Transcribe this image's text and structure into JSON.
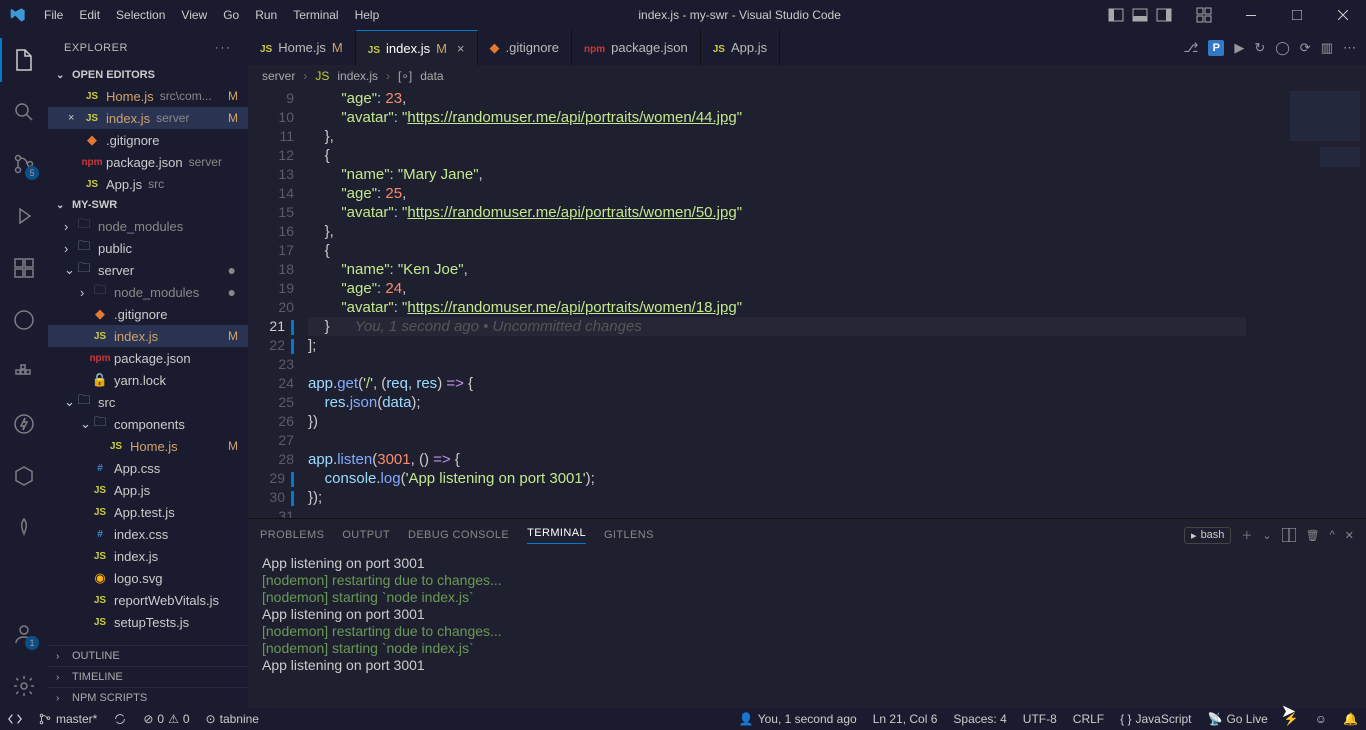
{
  "window": {
    "title": "index.js - my-swr - Visual Studio Code"
  },
  "menu": [
    "File",
    "Edit",
    "Selection",
    "View",
    "Go",
    "Run",
    "Terminal",
    "Help"
  ],
  "activity": {
    "scm_badge": "5",
    "acct_badge": "1"
  },
  "sidebar": {
    "title": "EXPLORER",
    "open_editors_label": "OPEN EDITORS",
    "open_editors": [
      {
        "name": "Home.js",
        "dir": "src\\com...",
        "mod": true
      },
      {
        "name": "index.js",
        "dir": "server",
        "mod": true,
        "active": true
      },
      {
        "name": ".gitignore",
        "dir": "",
        "mod": false
      },
      {
        "name": "package.json",
        "dir": "server",
        "mod": false
      },
      {
        "name": "App.js",
        "dir": "src",
        "mod": false
      }
    ],
    "project_label": "MY-SWR",
    "tree": [
      {
        "kind": "folder",
        "name": "node_modules",
        "pad": 1,
        "chev": "›",
        "faded": true
      },
      {
        "kind": "folder",
        "name": "public",
        "pad": 1,
        "chev": "›"
      },
      {
        "kind": "folder",
        "name": "server",
        "pad": 1,
        "chev": "⌄",
        "dot": true
      },
      {
        "kind": "folder",
        "name": "node_modules",
        "pad": 2,
        "chev": "›",
        "faded": true,
        "dot": true
      },
      {
        "kind": "file",
        "name": ".gitignore",
        "pad": 2,
        "ic": "git"
      },
      {
        "kind": "file",
        "name": "index.js",
        "pad": 2,
        "ic": "js",
        "mod": true,
        "sel": true
      },
      {
        "kind": "file",
        "name": "package.json",
        "pad": 2,
        "ic": "npm"
      },
      {
        "kind": "file",
        "name": "yarn.lock",
        "pad": 2,
        "ic": "lock"
      },
      {
        "kind": "folder",
        "name": "src",
        "pad": 1,
        "chev": "⌄"
      },
      {
        "kind": "folder",
        "name": "components",
        "pad": 2,
        "chev": "⌄"
      },
      {
        "kind": "file",
        "name": "Home.js",
        "pad": 3,
        "ic": "js",
        "mod": true
      },
      {
        "kind": "file",
        "name": "App.css",
        "pad": 2,
        "ic": "css"
      },
      {
        "kind": "file",
        "name": "App.js",
        "pad": 2,
        "ic": "js"
      },
      {
        "kind": "file",
        "name": "App.test.js",
        "pad": 2,
        "ic": "js"
      },
      {
        "kind": "file",
        "name": "index.css",
        "pad": 2,
        "ic": "css"
      },
      {
        "kind": "file",
        "name": "index.js",
        "pad": 2,
        "ic": "js"
      },
      {
        "kind": "file",
        "name": "logo.svg",
        "pad": 2,
        "ic": "svg"
      },
      {
        "kind": "file",
        "name": "reportWebVitals.js",
        "pad": 2,
        "ic": "js"
      },
      {
        "kind": "file",
        "name": "setupTests.js",
        "pad": 2,
        "ic": "js"
      }
    ],
    "outline": "OUTLINE",
    "timeline": "TIMELINE",
    "npm": "NPM SCRIPTS"
  },
  "tabs": [
    {
      "name": "Home.js",
      "mod": true
    },
    {
      "name": "index.js",
      "mod": true,
      "active": true
    },
    {
      "name": ".gitignore",
      "ic": "git"
    },
    {
      "name": "package.json",
      "ic": "npm"
    },
    {
      "name": "App.js"
    }
  ],
  "breadcrumb": {
    "a": "server",
    "b": "index.js",
    "c": "data"
  },
  "code": {
    "lines": [
      {
        "n": 9,
        "html": "        <span class='str'>\"age\"</span><span class='pun'>:</span> <span class='num'>23</span><span class='pl'>,</span>"
      },
      {
        "n": 10,
        "html": "        <span class='str'>\"avatar\"</span><span class='pun'>:</span> <span class='str'>\"<span class='url'>https://randomuser.me/api/portraits/women/44.jpg</span>\"</span>"
      },
      {
        "n": 11,
        "html": "    <span class='pl'>},</span>"
      },
      {
        "n": 12,
        "html": "    <span class='pl'>{</span>"
      },
      {
        "n": 13,
        "html": "        <span class='str'>\"name\"</span><span class='pun'>:</span> <span class='str'>\"Mary Jane\"</span><span class='pl'>,</span>"
      },
      {
        "n": 14,
        "html": "        <span class='str'>\"age\"</span><span class='pun'>:</span> <span class='num'>25</span><span class='pl'>,</span>"
      },
      {
        "n": 15,
        "html": "        <span class='str'>\"avatar\"</span><span class='pun'>:</span> <span class='str'>\"<span class='url'>https://randomuser.me/api/portraits/women/50.jpg</span>\"</span>"
      },
      {
        "n": 16,
        "html": "    <span class='pl'>},</span>"
      },
      {
        "n": 17,
        "html": "    <span class='pl'>{</span>"
      },
      {
        "n": 18,
        "html": "        <span class='str'>\"name\"</span><span class='pun'>:</span> <span class='str'>\"Ken Joe\"</span><span class='pl'>,</span>"
      },
      {
        "n": 19,
        "html": "        <span class='str'>\"age\"</span><span class='pun'>:</span> <span class='num'>24</span><span class='pl'>,</span>"
      },
      {
        "n": 20,
        "html": "        <span class='str'>\"avatar\"</span><span class='pun'>:</span> <span class='str'>\"<span class='url'>https://randomuser.me/api/portraits/women/18.jpg</span>\"</span>"
      },
      {
        "n": 21,
        "cur": true,
        "html": "    <span class='pl'>}</span>      <span class='cm-inline'>You, 1 second ago • Uncommitted changes</span>",
        "mark": true
      },
      {
        "n": 22,
        "html": "<span class='pl'>];</span>",
        "mark": true
      },
      {
        "n": 23,
        "html": ""
      },
      {
        "n": 24,
        "html": "<span class='var'>app</span><span class='pl'>.</span><span class='fn'>get</span><span class='pl'>(</span><span class='str'>'/'</span><span class='pl'>, (</span><span class='var'>req</span><span class='pl'>, </span><span class='var'>res</span><span class='pl'>) </span><span class='key'>=&gt;</span><span class='pl'> {</span>"
      },
      {
        "n": 25,
        "html": "    <span class='var'>res</span><span class='pl'>.</span><span class='fn'>json</span><span class='pl'>(</span><span class='var'>data</span><span class='pl'>);</span>"
      },
      {
        "n": 26,
        "html": "<span class='pl'>})</span>"
      },
      {
        "n": 27,
        "html": ""
      },
      {
        "n": 28,
        "html": "<span class='var'>app</span><span class='pl'>.</span><span class='fn'>listen</span><span class='pl'>(</span><span class='num'>3001</span><span class='pl'>, () </span><span class='key'>=&gt;</span><span class='pl'> {</span>"
      },
      {
        "n": 29,
        "html": "    <span class='var'>console</span><span class='pl'>.</span><span class='fn'>log</span><span class='pl'>(</span><span class='str'>'App listening on port 3001'</span><span class='pl'>);</span>",
        "mark": true
      },
      {
        "n": 30,
        "html": "<span class='pl'>});</span>",
        "mark": true
      },
      {
        "n": 31,
        "html": ""
      }
    ]
  },
  "panel": {
    "tabs": [
      "PROBLEMS",
      "OUTPUT",
      "DEBUG CONSOLE",
      "TERMINAL",
      "GITLENS"
    ],
    "active": "TERMINAL",
    "shell": "bash",
    "lines": [
      {
        "cls": "ok",
        "t": "App listening on port 3001"
      },
      {
        "cls": "green",
        "t": "[nodemon] restarting due to changes..."
      },
      {
        "cls": "green",
        "t": "[nodemon] starting `node index.js`"
      },
      {
        "cls": "ok",
        "t": "App listening on port 3001"
      },
      {
        "cls": "green",
        "t": "[nodemon] restarting due to changes..."
      },
      {
        "cls": "green",
        "t": "[nodemon] starting `node index.js`"
      },
      {
        "cls": "ok",
        "t": "App listening on port 3001"
      }
    ]
  },
  "status": {
    "branch": "master*",
    "errors": "0",
    "warnings": "0",
    "tabnine": "tabnine",
    "blame": "You, 1 second ago",
    "pos": "Ln 21, Col 6",
    "spaces": "Spaces: 4",
    "enc": "UTF-8",
    "eol": "CRLF",
    "lang": "JavaScript",
    "live": "Go Live"
  }
}
